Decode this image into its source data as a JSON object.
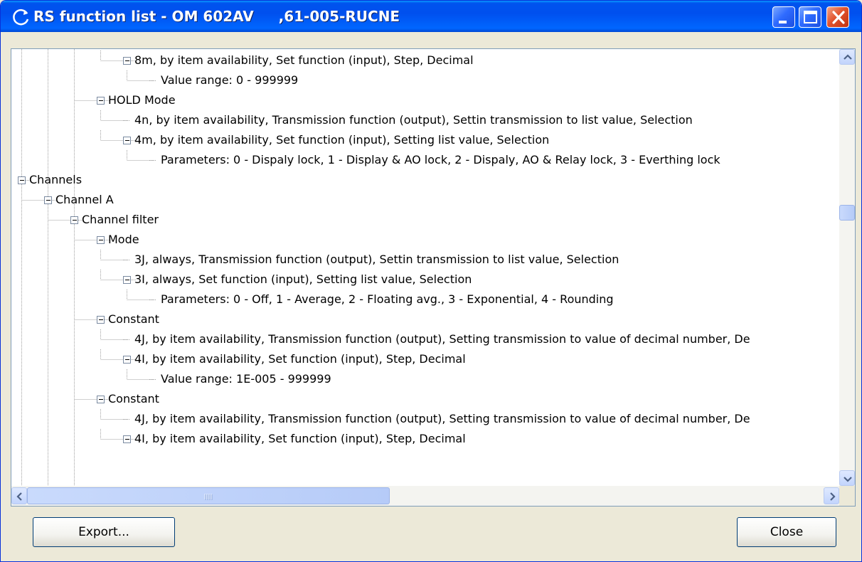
{
  "window": {
    "title": "RS function list - OM 602AV     ,61-005-RUCNE"
  },
  "tree": {
    "rows": [
      {
        "text": "8m, by item availability, Set function (input), Step, Decimal",
        "level": 4,
        "expander": "minus"
      },
      {
        "text": "Value range: 0  -  999999",
        "level": 5,
        "expander": "none"
      },
      {
        "text": "HOLD Mode",
        "level": 3,
        "expander": "minus"
      },
      {
        "text": "4n, by item availability, Transmission function (output), Settin transmission to list value, Selection",
        "level": 4,
        "expander": "none"
      },
      {
        "text": "4m, by item availability, Set function (input), Setting list value, Selection",
        "level": 4,
        "expander": "minus"
      },
      {
        "text": "Parameters: 0 - Dispaly lock, 1 - Display & AO lock, 2 - Dispaly, AO & Relay lock, 3 - Everthing lock",
        "level": 5,
        "expander": "none"
      },
      {
        "text": "Channels",
        "level": 0,
        "expander": "minus"
      },
      {
        "text": "Channel A",
        "level": 1,
        "expander": "minus"
      },
      {
        "text": "Channel filter",
        "level": 2,
        "expander": "minus"
      },
      {
        "text": "Mode",
        "level": 3,
        "expander": "minus"
      },
      {
        "text": "3J, always, Transmission function (output), Settin transmission to list value, Selection",
        "level": 4,
        "expander": "none"
      },
      {
        "text": "3I, always, Set function (input), Setting list value, Selection",
        "level": 4,
        "expander": "minus"
      },
      {
        "text": "Parameters: 0 - Off, 1 - Average, 2 - Floating avg., 3 - Exponential, 4 - Rounding",
        "level": 5,
        "expander": "none"
      },
      {
        "text": "Constant",
        "level": 3,
        "expander": "minus"
      },
      {
        "text": "4J, by item availability, Transmission function (output), Setting transmission to value of decimal number, De",
        "level": 4,
        "expander": "none"
      },
      {
        "text": "4I, by item availability, Set function (input), Step, Decimal",
        "level": 4,
        "expander": "minus"
      },
      {
        "text": "Value range: 1E-005  -  999999",
        "level": 5,
        "expander": "none"
      },
      {
        "text": "Constant",
        "level": 3,
        "expander": "minus"
      },
      {
        "text": "4J, by item availability, Transmission function (output), Setting transmission to value of decimal number, De",
        "level": 4,
        "expander": "none"
      },
      {
        "text": "4I, by item availability, Set function (input), Step, Decimal",
        "level": 4,
        "expander": "minus"
      }
    ]
  },
  "scroll": {
    "vertical_position": 0.36,
    "horizontal_position": 0.0
  },
  "buttons": {
    "export_label": "Export...",
    "close_label": "Close"
  },
  "colors": {
    "titlebar": "#0054e3",
    "window_face": "#ece9d8",
    "close_button": "#e2542e"
  }
}
